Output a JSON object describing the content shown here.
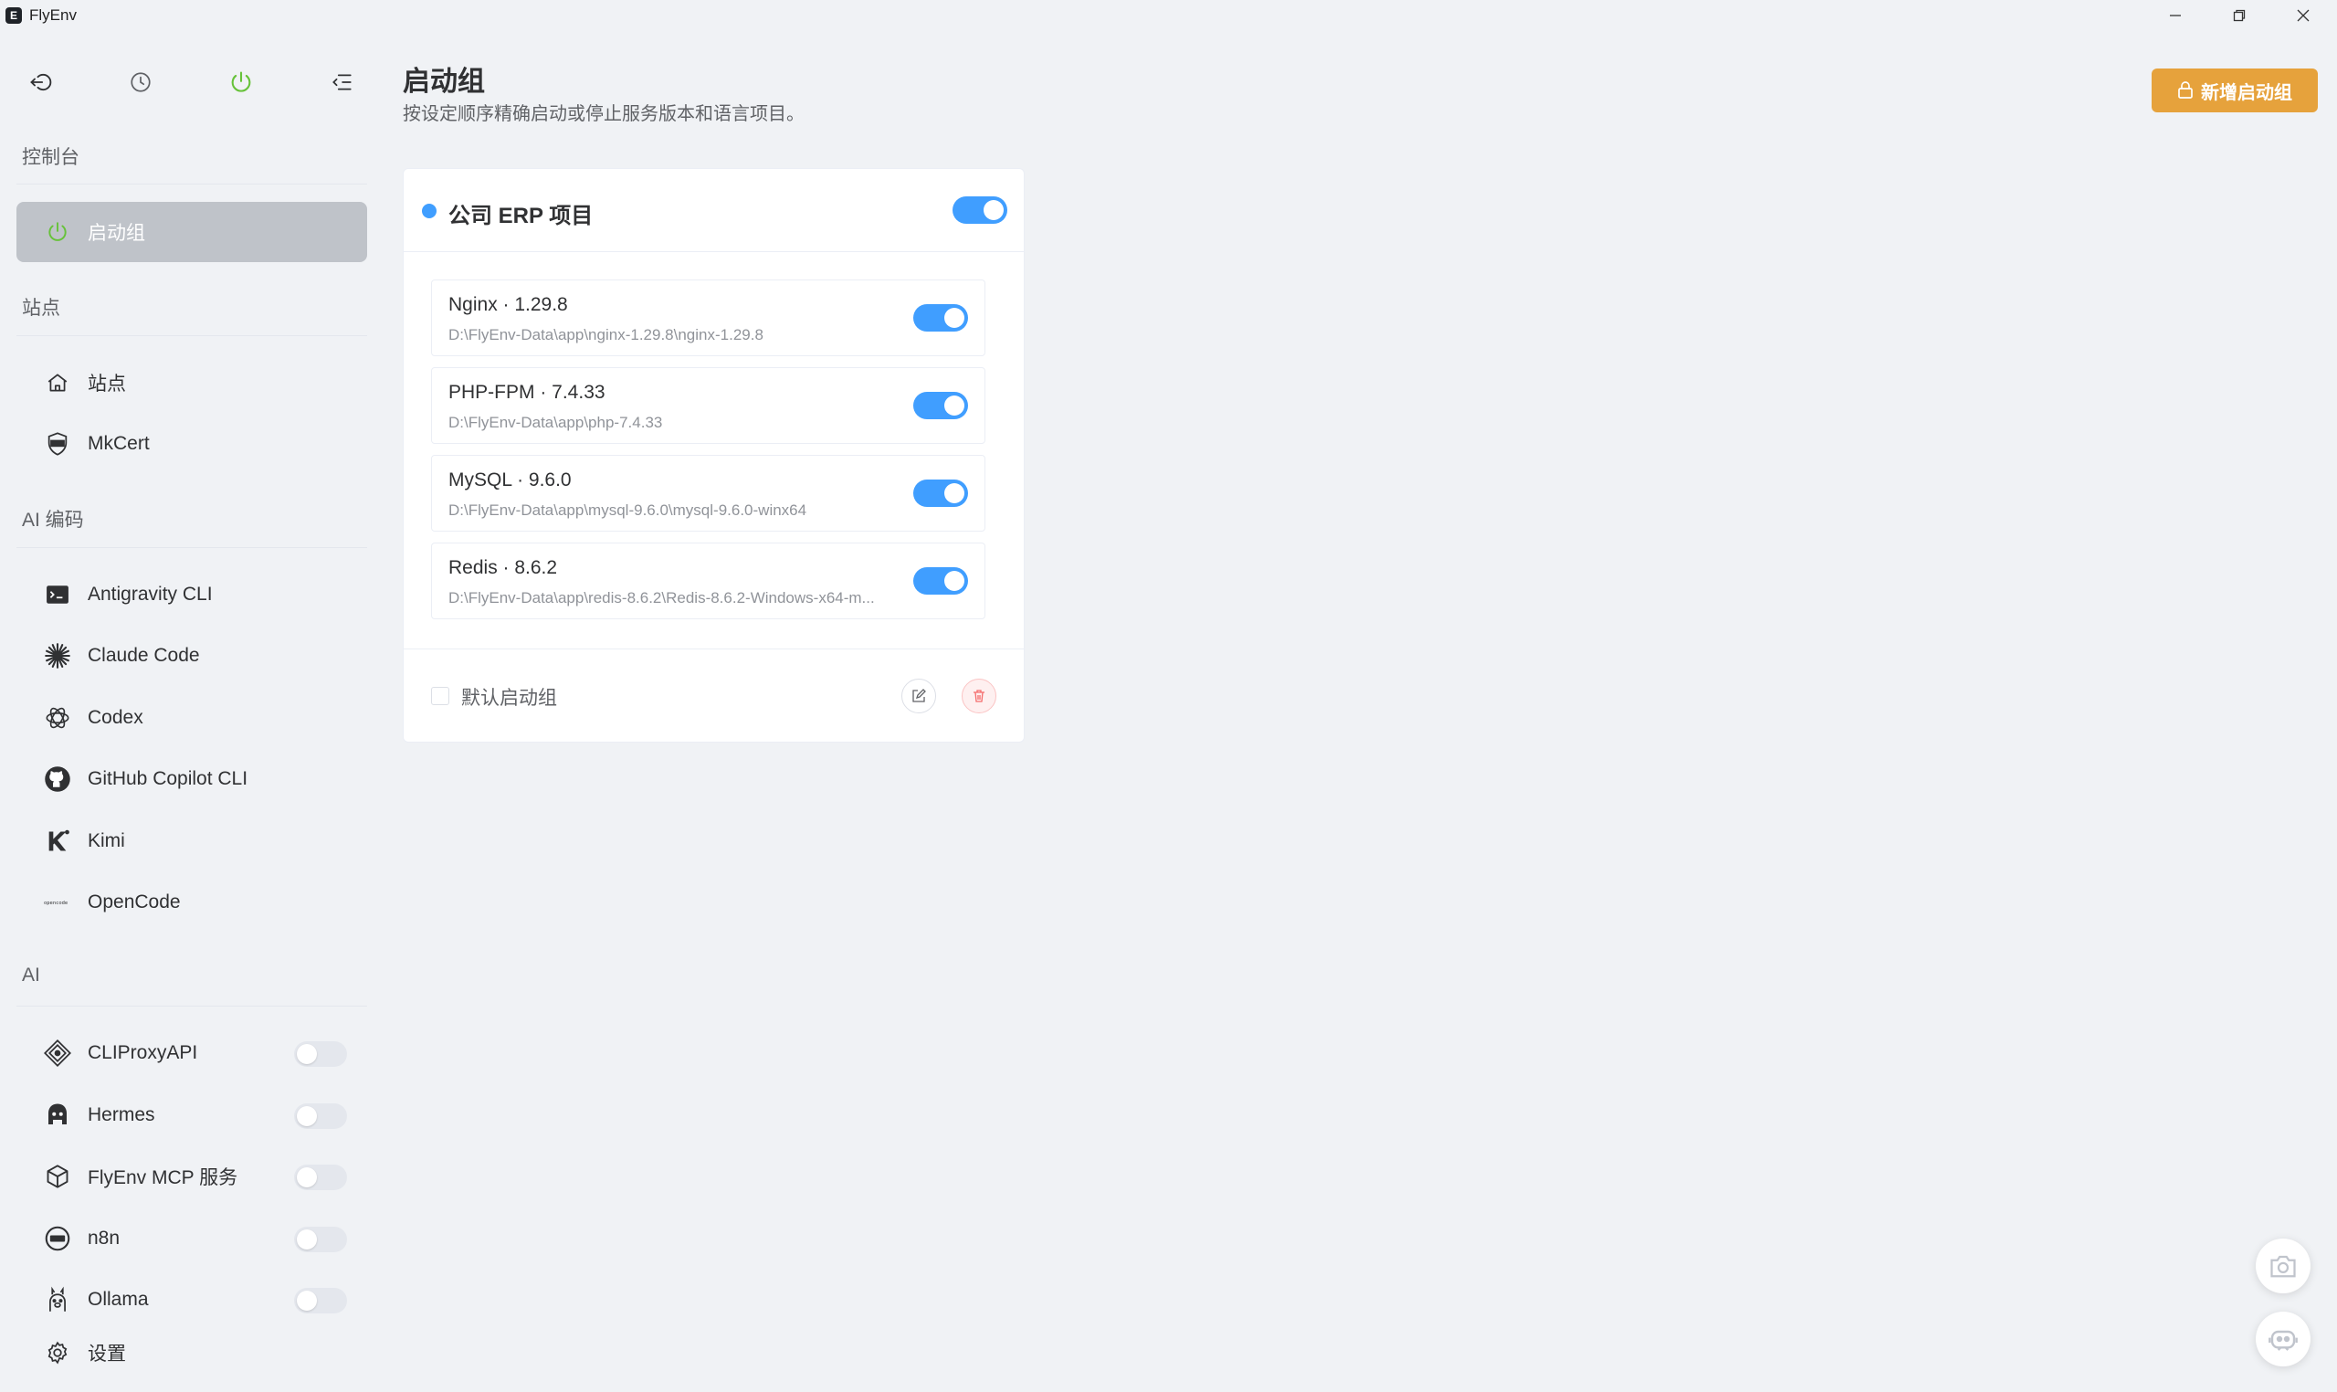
{
  "window": {
    "title": "FlyEnv",
    "logo_letter": "E",
    "controls": [
      "minimize-icon",
      "restore-icon",
      "close-icon"
    ]
  },
  "sidebar": {
    "top_icons": [
      "login-icon",
      "clock-icon",
      "power-icon",
      "menu-collapse-icon"
    ],
    "sections": [
      {
        "title": "控制台",
        "items": [
          {
            "label": "启动组",
            "icon": "power-icon",
            "active": true
          }
        ]
      },
      {
        "title": "站点",
        "items": [
          {
            "label": "站点",
            "icon": "home-icon"
          },
          {
            "label": "MkCert",
            "icon": "ssl-shield-icon"
          }
        ]
      },
      {
        "title": "AI 编码",
        "items": [
          {
            "label": "Antigravity CLI",
            "icon": "terminal-icon"
          },
          {
            "label": "Claude Code",
            "icon": "claude-starburst-icon"
          },
          {
            "label": "Codex",
            "icon": "openai-icon"
          },
          {
            "label": "GitHub Copilot CLI",
            "icon": "github-icon"
          },
          {
            "label": "Kimi",
            "icon": "kimi-icon"
          },
          {
            "label": "OpenCode",
            "icon": "opencode-logo-icon"
          }
        ]
      },
      {
        "title": "AI",
        "items": [
          {
            "label": "CLIProxyAPI",
            "icon": "diamond-icon",
            "toggle": false
          },
          {
            "label": "Hermes",
            "icon": "hermes-icon",
            "toggle": false
          },
          {
            "label": "FlyEnv MCP 服务",
            "icon": "cube-icon",
            "toggle": false
          },
          {
            "label": "n8n",
            "icon": "n8n-icon",
            "toggle": false
          },
          {
            "label": "Ollama",
            "icon": "ollama-icon",
            "toggle": false
          }
        ]
      }
    ],
    "settings_label": "设置",
    "opencode_logo_text": "opencode"
  },
  "main": {
    "title": "启动组",
    "subtitle": "按设定顺序精确启动或停止服务版本和语言项目。",
    "add_button": "新增启动组",
    "group": {
      "name": "公司 ERP 项目",
      "enabled": true,
      "accent": "#409eff",
      "services": [
        {
          "name": "Nginx · 1.29.8",
          "path": "D:\\FlyEnv-Data\\app\\nginx-1.29.8\\nginx-1.29.8",
          "enabled": true
        },
        {
          "name": "PHP-FPM · 7.4.33",
          "path": "D:\\FlyEnv-Data\\app\\php-7.4.33",
          "enabled": true
        },
        {
          "name": "MySQL · 9.6.0",
          "path": "D:\\FlyEnv-Data\\app\\mysql-9.6.0\\mysql-9.6.0-winx64",
          "enabled": true
        },
        {
          "name": "Redis · 8.6.2",
          "path": "D:\\FlyEnv-Data\\app\\redis-8.6.2\\Redis-8.6.2-Windows-x64-m...",
          "enabled": true
        }
      ],
      "default_label": "默认启动组",
      "default_checked": false
    },
    "floating_buttons": [
      "camera-icon",
      "robot-icon"
    ]
  },
  "colors": {
    "primary": "#409eff",
    "warning": "#e6a23c",
    "success": "#67c23a",
    "danger": "#f56c6c",
    "active_nav": "#bfc3c9"
  }
}
